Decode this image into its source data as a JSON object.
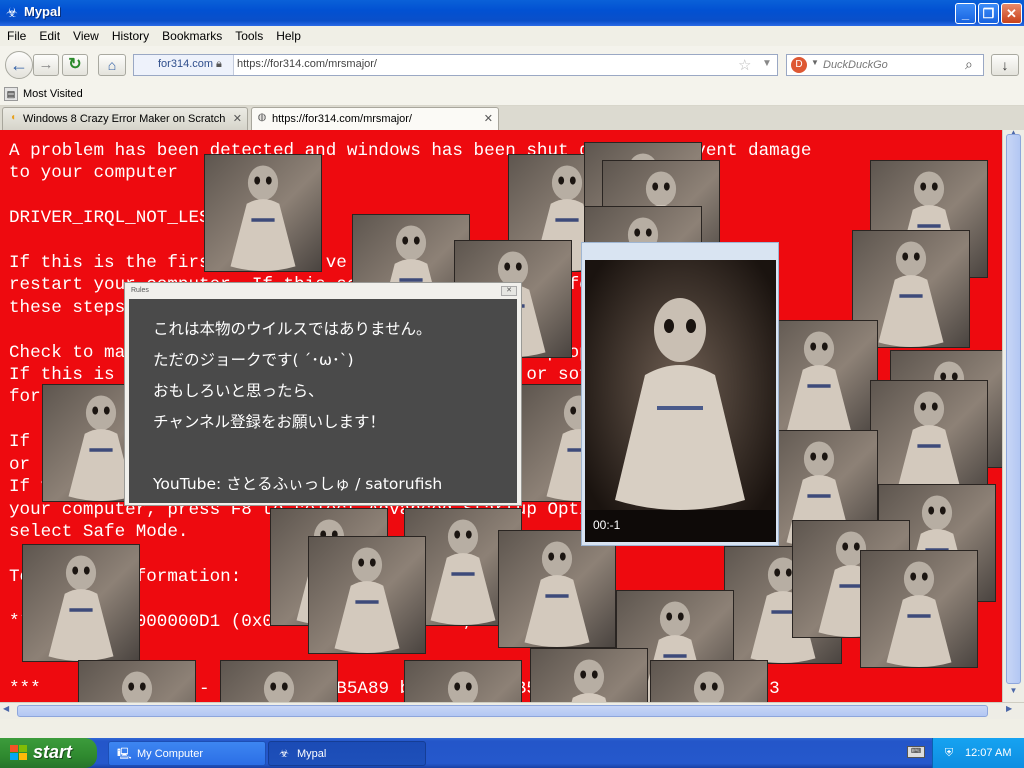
{
  "window": {
    "title": "Mypal",
    "minimize": "_",
    "maximize": "❐",
    "close": "✕"
  },
  "menu": [
    "File",
    "Edit",
    "View",
    "History",
    "Bookmarks",
    "Tools",
    "Help"
  ],
  "nav": {
    "site_identity": "for314.com",
    "url": "https://for314.com/mrsmajor/",
    "search_placeholder": "DuckDuckGo",
    "back_icon": "back-arrow-icon",
    "forward_icon": "forward-arrow-icon",
    "reload_icon": "reload-icon",
    "home_icon": "home-icon",
    "download_icon": "download-icon"
  },
  "bookmarks": {
    "most_visited": "Most Visited"
  },
  "tabs": [
    {
      "label": "Windows 8 Crazy Error Maker on Scratch",
      "active": false
    },
    {
      "label": "https://for314.com/mrsmajor/",
      "active": true
    }
  ],
  "bsod_text": [
    "A problem has been detected and windows has been shut down to prevent damage",
    "to your computer",
    "",
    "DRIVER_IRQL_NOT_LESS_OR_EQUAL",
    "",
    "If this is the first time you've seen this stop error screen,",
    "restart your computer. If this screen appears again, follow",
    "these steps:",
    "",
    "Check to make sure any new hardware or software is properly installed.",
    "If this is a new installation, ask your hardware or software manufacturer",
    "for any windows updates you might need.",
    "",
    "If problems continue, disable or remove any newly installed hardware",
    "or software. Disable BIOS memory options such as caching or shadowing.",
    "If you need to use Safe Mode to remove or disable components, restart",
    "your computer, press F8 to select Advanced Startup Options, and then",
    "select Safe Mode.",
    "",
    "Technical information:",
    "",
    "*** STOP: 0x000000D1 (0x0000000C,0x00000002,0x00000000,0xF86B5A89)",
    "",
    "",
    "***       gv3.sys - Address F86B5A89 base at F86B5000, DateStamp 48a40333"
  ],
  "rules_dialog": {
    "title": "Rules",
    "close": "✕",
    "lines": [
      "これは本物のウイルスではありません。",
      "ただのジョークです( ´･ω･`)",
      "おもしろいと思ったら、",
      "チャンネル登録をお願いします！",
      "",
      "YouTube:  さとるふぃっしゅ / satorufish"
    ]
  },
  "video": {
    "time": "00:-1"
  },
  "taskbar": {
    "start_label": "start",
    "items": [
      {
        "label": "My Computer",
        "icon": "computer-icon"
      },
      {
        "label": "Mypal",
        "icon": "mypal-icon"
      }
    ],
    "clock": "12:07 AM"
  },
  "colors": {
    "error_bg": "#ee0a0f",
    "dialog_bg": "#4a4a4a",
    "taskbar": "#2456c9"
  }
}
